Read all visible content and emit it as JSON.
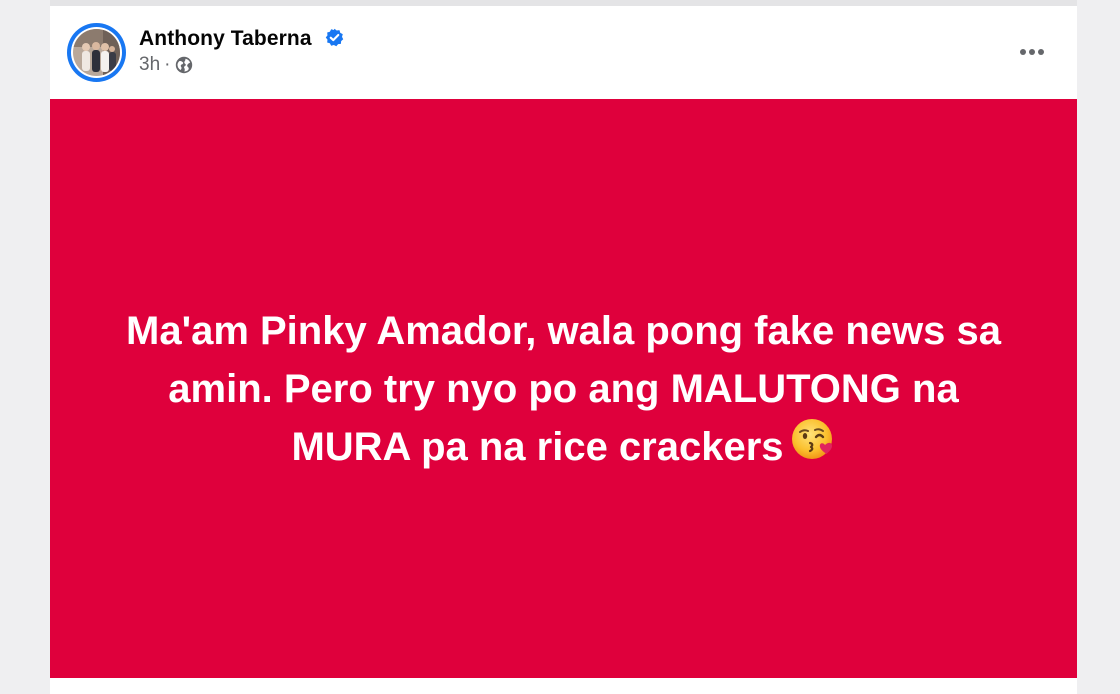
{
  "post": {
    "author_name": "Anthony Taberna",
    "verified": true,
    "timestamp": "3h",
    "separator": "·",
    "audience_icon": "globe-icon",
    "more_options_icon": "more-horizontal-icon",
    "text_line_1": "Ma'am Pinky Amador, wala pong fake news sa",
    "text_line_2": "amin. Pero try nyo po ang MALUTONG na",
    "text_line_3": "MURA pa na rice crackers",
    "emoji": "face-blowing-a-kiss-emoji",
    "background_color": "#df003c",
    "text_color": "#ffffff"
  },
  "colors": {
    "verified_blue": "#1877f2",
    "meta_gray": "#65676b",
    "name_black": "#050505"
  }
}
